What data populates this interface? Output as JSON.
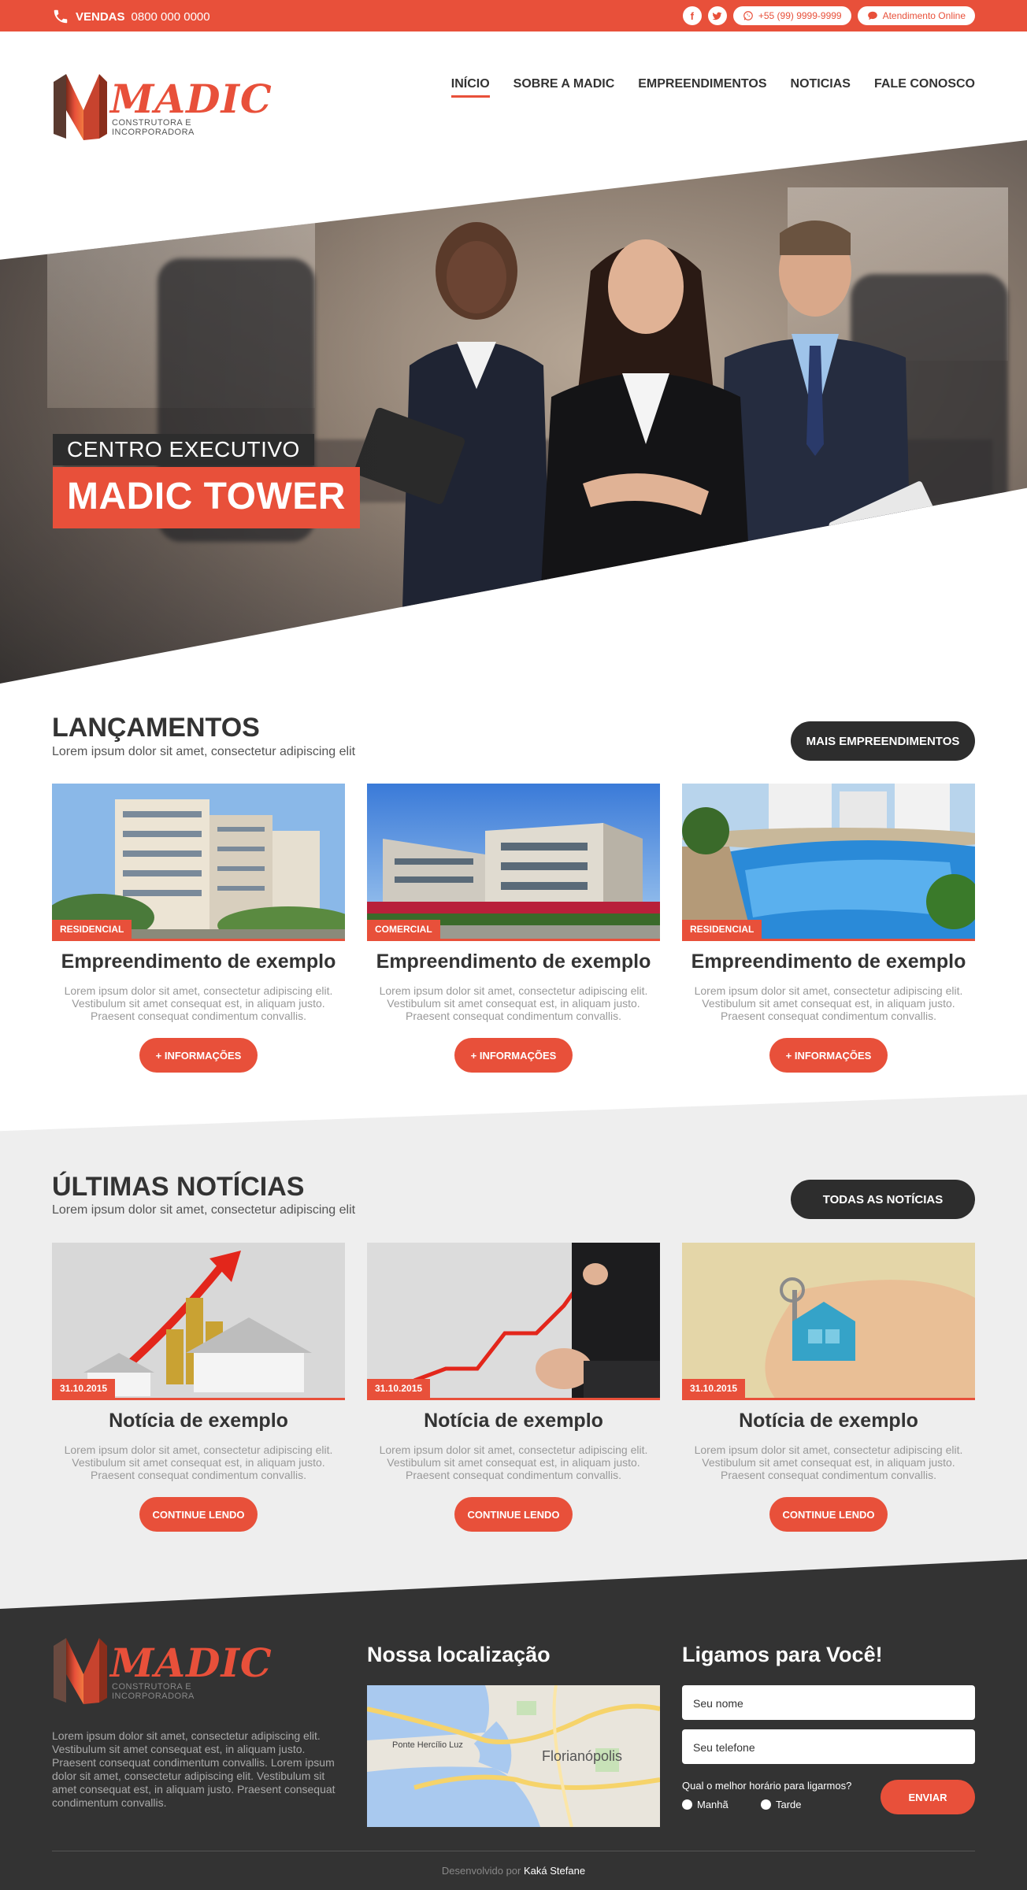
{
  "topbar": {
    "sales_label": "VENDAS",
    "sales_phone": "0800 000 0000",
    "whatsapp": "+55 (99) 9999-9999",
    "online": "Atendimento Online"
  },
  "brand": {
    "name": "MADIC",
    "tagline": "CONSTRUTORA E INCORPORADORA"
  },
  "nav": [
    "INÍCIO",
    "SOBRE A MADIC",
    "EMPREENDIMENTOS",
    "NOTICIAS",
    "FALE CONOSCO"
  ],
  "hero": {
    "line1": "CENTRO EXECUTIVO",
    "line2": "MADIC TOWER"
  },
  "launches": {
    "title": "LANÇAMENTOS",
    "subtitle": "Lorem ipsum dolor sit amet, consectetur adipiscing elit",
    "more": "MAIS EMPREENDIMENTOS",
    "items": [
      {
        "badge": "RESIDENCIAL",
        "title": "Empreendimento de exemplo",
        "text": "Lorem ipsum dolor sit amet, consectetur adipiscing elit. Vestibulum sit amet consequat est, in aliquam justo. Praesent consequat condimentum convallis.",
        "button": "+ INFORMAÇÕES"
      },
      {
        "badge": "COMERCIAL",
        "title": "Empreendimento de exemplo",
        "text": "Lorem ipsum dolor sit amet, consectetur adipiscing elit. Vestibulum sit amet consequat est, in aliquam justo. Praesent consequat condimentum convallis.",
        "button": "+ INFORMAÇÕES"
      },
      {
        "badge": "RESIDENCIAL",
        "title": "Empreendimento de exemplo",
        "text": "Lorem ipsum dolor sit amet, consectetur adipiscing elit. Vestibulum sit amet consequat est, in aliquam justo. Praesent consequat condimentum convallis.",
        "button": "+ INFORMAÇÕES"
      }
    ]
  },
  "news": {
    "title": "ÚLTIMAS NOTÍCIAS",
    "subtitle": "Lorem ipsum dolor sit amet, consectetur adipiscing elit",
    "more": "TODAS AS NOTÍCIAS",
    "items": [
      {
        "badge": "31.10.2015",
        "title": "Notícia de exemplo",
        "text": "Lorem ipsum dolor sit amet, consectetur adipiscing elit. Vestibulum sit amet consequat est, in aliquam justo. Praesent consequat condimentum convallis.",
        "button": "CONTINUE LENDO"
      },
      {
        "badge": "31.10.2015",
        "title": "Notícia de exemplo",
        "text": "Lorem ipsum dolor sit amet, consectetur adipiscing elit. Vestibulum sit amet consequat est, in aliquam justo. Praesent consequat condimentum convallis.",
        "button": "CONTINUE LENDO"
      },
      {
        "badge": "31.10.2015",
        "title": "Notícia de exemplo",
        "text": "Lorem ipsum dolor sit amet, consectetur adipiscing elit. Vestibulum sit amet consequat est, in aliquam justo. Praesent consequat condimentum convallis.",
        "button": "CONTINUE LENDO"
      }
    ]
  },
  "footer": {
    "about": "Lorem ipsum dolor sit amet, consectetur adipiscing elit. Vestibulum sit amet consequat est, in aliquam justo. Praesent consequat condimentum convallis. Lorem ipsum dolor sit amet, consectetur adipiscing elit. Vestibulum sit amet consequat est, in aliquam justo. Praesent consequat condimentum convallis.",
    "location_title": "Nossa localização",
    "map_label_bridge": "Ponte Hercílio Luz",
    "map_label_city": "Florianópolis",
    "callback_title": "Ligamos para Você!",
    "name_placeholder": "Seu nome",
    "phone_placeholder": "Seu telefone",
    "question": "Qual o melhor horário para ligarmos?",
    "opt_morning": "Manhã",
    "opt_afternoon": "Tarde",
    "send": "ENVIAR",
    "credits_prefix": "Desenvolvido por",
    "credits_name": "Kaká Stefane"
  },
  "colors": {
    "accent": "#e8503a",
    "dark": "#2d2d2d",
    "footer": "#333333"
  }
}
